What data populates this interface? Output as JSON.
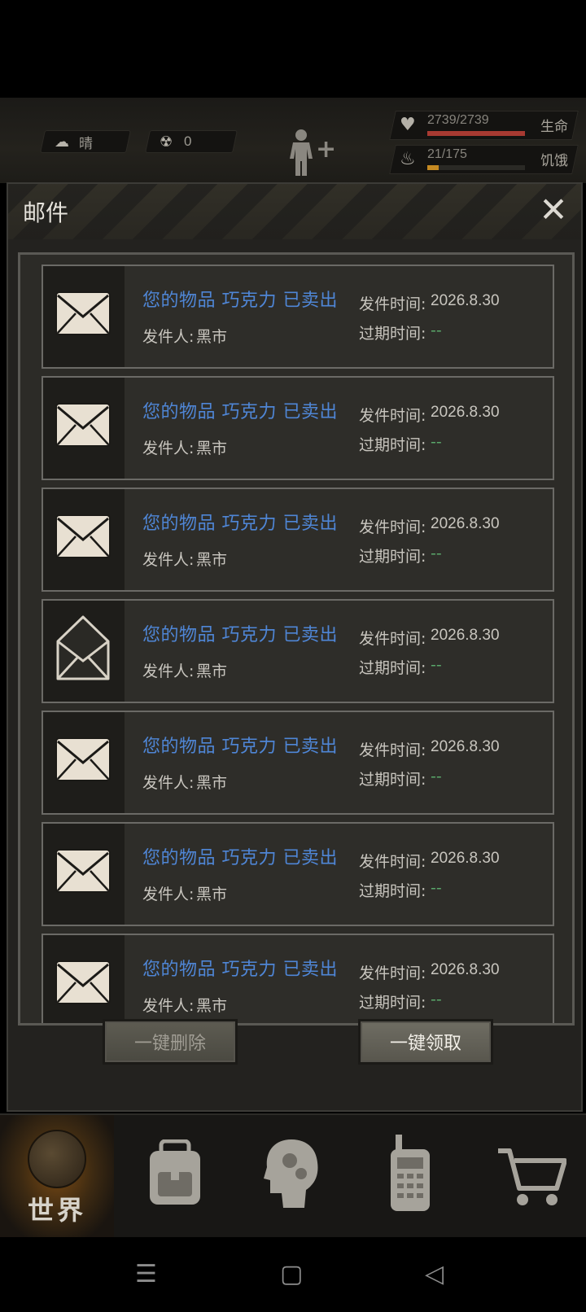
{
  "hud": {
    "weather": "晴",
    "radiation": "0",
    "hp_value": "2739/2739",
    "hp_label": "生命",
    "hp_fraction": 1.0,
    "hunger_value": "21/175",
    "hunger_label": "饥饿",
    "hunger_fraction": 0.12,
    "hp_color": "#a83a32",
    "hunger_color": "#c58a22"
  },
  "panel": {
    "title": "邮件",
    "close_glyph": "✕"
  },
  "mails": [
    {
      "subject": "您的物品 巧克力 已卖出",
      "sender_label": "发件人:",
      "sender": "黑市",
      "send_label": "发件时间:",
      "send_time": "2026.8.30",
      "expire_label": "过期时间:",
      "expire": "--",
      "opened": false
    },
    {
      "subject": "您的物品 巧克力 已卖出",
      "sender_label": "发件人:",
      "sender": "黑市",
      "send_label": "发件时间:",
      "send_time": "2026.8.30",
      "expire_label": "过期时间:",
      "expire": "--",
      "opened": false
    },
    {
      "subject": "您的物品 巧克力 已卖出",
      "sender_label": "发件人:",
      "sender": "黑市",
      "send_label": "发件时间:",
      "send_time": "2026.8.30",
      "expire_label": "过期时间:",
      "expire": "--",
      "opened": false
    },
    {
      "subject": "您的物品 巧克力 已卖出",
      "sender_label": "发件人:",
      "sender": "黑市",
      "send_label": "发件时间:",
      "send_time": "2026.8.30",
      "expire_label": "过期时间:",
      "expire": "--",
      "opened": true
    },
    {
      "subject": "您的物品 巧克力 已卖出",
      "sender_label": "发件人:",
      "sender": "黑市",
      "send_label": "发件时间:",
      "send_time": "2026.8.30",
      "expire_label": "过期时间:",
      "expire": "--",
      "opened": false
    },
    {
      "subject": "您的物品 巧克力 已卖出",
      "sender_label": "发件人:",
      "sender": "黑市",
      "send_label": "发件时间:",
      "send_time": "2026.8.30",
      "expire_label": "过期时间:",
      "expire": "--",
      "opened": false
    },
    {
      "subject": "您的物品 巧克力 已卖出",
      "sender_label": "发件人:",
      "sender": "黑市",
      "send_label": "发件时间:",
      "send_time": "2026.8.30",
      "expire_label": "过期时间:",
      "expire": "--",
      "opened": false
    }
  ],
  "buttons": {
    "delete_all": "一键删除",
    "claim_all": "一键领取"
  },
  "nav": {
    "world_label": "世界",
    "icons": [
      "globe-icon",
      "backpack-icon",
      "brain-icon",
      "radio-icon",
      "cart-icon"
    ]
  },
  "system": {
    "menu_glyph": "☰",
    "home_glyph": "▢",
    "back_glyph": "◁"
  }
}
